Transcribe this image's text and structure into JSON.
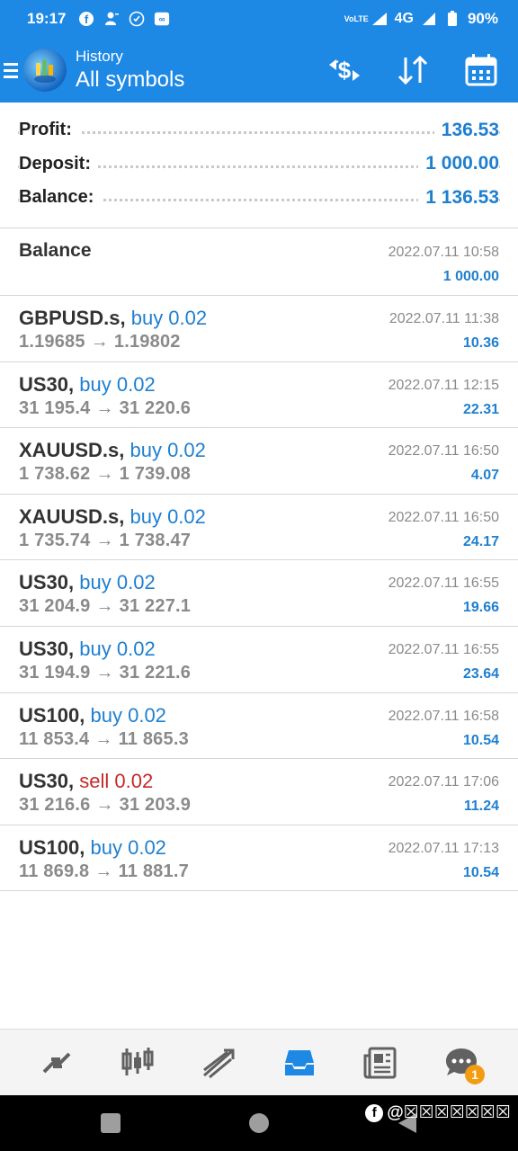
{
  "status_bar": {
    "time": "19:17",
    "network": "4G",
    "volte": "VoLTE",
    "battery": "90%"
  },
  "app_bar": {
    "subtitle": "History",
    "title": "All symbols"
  },
  "summary": [
    {
      "label": "Profit:",
      "value": "136.53"
    },
    {
      "label": "Deposit:",
      "value": "1 000.00"
    },
    {
      "label": "Balance:",
      "value": "1 136.53"
    }
  ],
  "balance_entry": {
    "label": "Balance",
    "datetime": "2022.07.11 10:58",
    "amount": "1 000.00"
  },
  "deals": [
    {
      "symbol": "GBPUSD.s,",
      "direction": "buy 0.02",
      "type": "buy",
      "open": "1.19685",
      "close": "1.19802",
      "datetime": "2022.07.11 11:38",
      "profit": "10.36"
    },
    {
      "symbol": "US30,",
      "direction": "buy 0.02",
      "type": "buy",
      "open": "31 195.4",
      "close": "31 220.6",
      "datetime": "2022.07.11 12:15",
      "profit": "22.31"
    },
    {
      "symbol": "XAUUSD.s,",
      "direction": "buy 0.02",
      "type": "buy",
      "open": "1 738.62",
      "close": "1 739.08",
      "datetime": "2022.07.11 16:50",
      "profit": "4.07"
    },
    {
      "symbol": "XAUUSD.s,",
      "direction": "buy 0.02",
      "type": "buy",
      "open": "1 735.74",
      "close": "1 738.47",
      "datetime": "2022.07.11 16:50",
      "profit": "24.17"
    },
    {
      "symbol": "US30,",
      "direction": "buy 0.02",
      "type": "buy",
      "open": "31 204.9",
      "close": "31 227.1",
      "datetime": "2022.07.11 16:55",
      "profit": "19.66"
    },
    {
      "symbol": "US30,",
      "direction": "buy 0.02",
      "type": "buy",
      "open": "31 194.9",
      "close": "31 221.6",
      "datetime": "2022.07.11 16:55",
      "profit": "23.64"
    },
    {
      "symbol": "US100,",
      "direction": "buy 0.02",
      "type": "buy",
      "open": "11 853.4",
      "close": "11 865.3",
      "datetime": "2022.07.11 16:58",
      "profit": "10.54"
    },
    {
      "symbol": "US30,",
      "direction": "sell 0.02",
      "type": "sell",
      "open": "31 216.6",
      "close": "31 203.9",
      "datetime": "2022.07.11 17:06",
      "profit": "11.24"
    },
    {
      "symbol": "US100,",
      "direction": "buy 0.02",
      "type": "buy",
      "open": "11 869.8",
      "close": "11 881.7",
      "datetime": "2022.07.11 17:13",
      "profit": "10.54"
    }
  ],
  "price_arrow": "→",
  "bottom_nav": {
    "items": [
      "quotes-icon",
      "chart-icon",
      "trade-icon",
      "history-icon",
      "news-icon",
      "chat-icon"
    ],
    "active": "history-icon",
    "chat_badge": "1"
  },
  "watermark": {
    "fb": "f",
    "text": "@☒☒☒☒☒☒☒"
  },
  "colors": {
    "primary": "#1e88e5",
    "value_blue": "#1e7fd0",
    "sell_red": "#c62828",
    "muted": "#8a8a8a"
  }
}
